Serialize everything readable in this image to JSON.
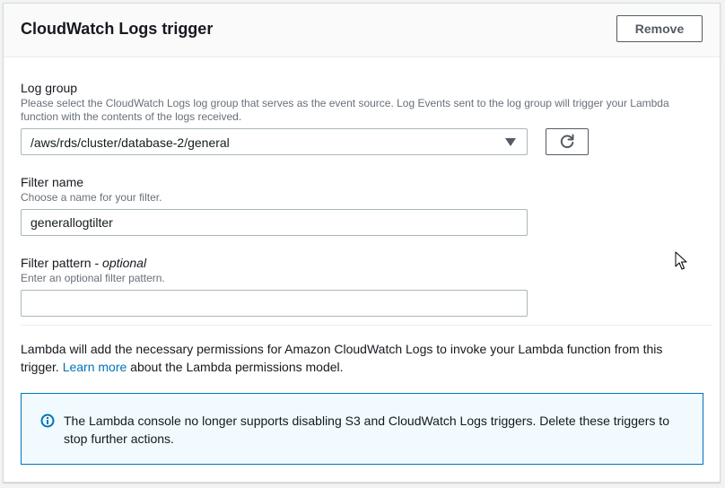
{
  "panel": {
    "title": "CloudWatch Logs trigger",
    "remove_label": "Remove"
  },
  "log_group": {
    "label": "Log group",
    "description": "Please select the CloudWatch Logs log group that serves as the event source. Log Events sent to the log group will trigger your Lambda function with the contents of the logs received.",
    "selected": "/aws/rds/cluster/database-2/general",
    "refresh_icon": "refresh-icon"
  },
  "filter_name": {
    "label": "Filter name",
    "description": "Choose a name for your filter.",
    "value": "generallogtilter"
  },
  "filter_pattern": {
    "label": "Filter pattern - ",
    "label_optional": "optional",
    "description": "Enter an optional filter pattern.",
    "value": ""
  },
  "permissions": {
    "text_before": "Lambda will add the necessary permissions for Amazon CloudWatch Logs to invoke your Lambda function from this trigger. ",
    "link": "Learn more",
    "text_after": " about the Lambda permissions model."
  },
  "info": {
    "icon": "info-icon",
    "text": "The Lambda console no longer supports disabling S3 and CloudWatch Logs triggers. Delete these triggers to stop further actions."
  },
  "colors": {
    "link": "#0073bb",
    "info_border": "#0073bb",
    "info_bg": "#f1faff"
  }
}
